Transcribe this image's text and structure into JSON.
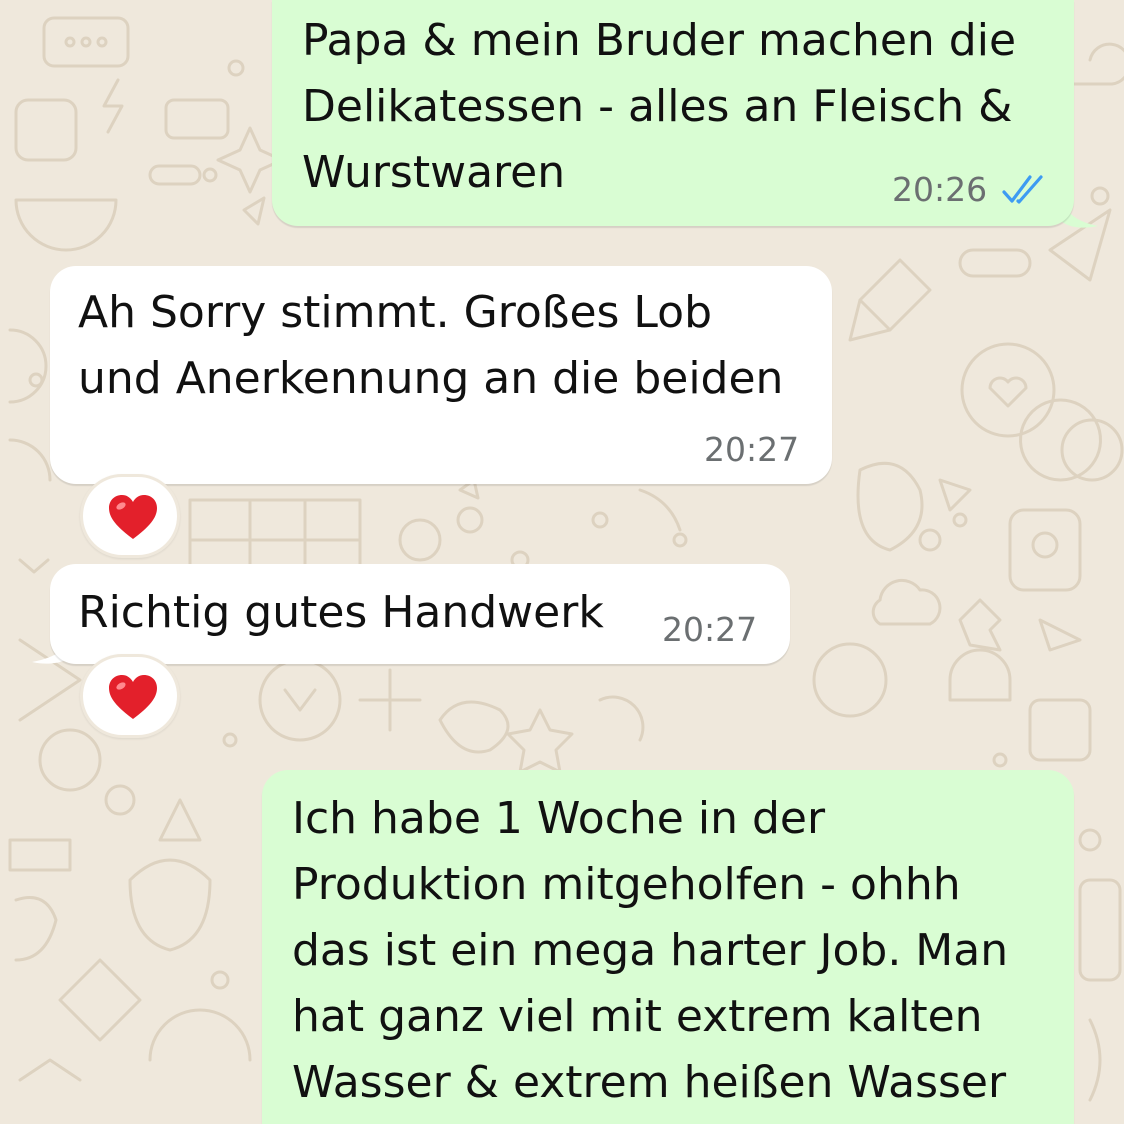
{
  "messages": [
    {
      "direction": "outgoing",
      "text": "Papa & mein Bruder machen die\nDelikatessen - alles an Fleisch &\nWurstwaren",
      "time": "20:26",
      "status": "read-double-check-icon"
    },
    {
      "direction": "incoming",
      "text": "Ah Sorry stimmt. Großes Lob\nund Anerkennung an die beiden",
      "time": "20:27",
      "reaction": "red-heart"
    },
    {
      "direction": "incoming",
      "text": "Richtig gutes Handwerk",
      "time": "20:27",
      "reaction": "red-heart"
    },
    {
      "direction": "outgoing",
      "text": "Ich habe 1 Woche in der\nProduktion mitgeholfen - ohhh\ndas ist ein mega harter Job. Man\nhat ganz viel mit extrem kalten\nWasser & extrem heißen Wasser"
    }
  ],
  "colors": {
    "outgoing_bubble": "#d9fdd3",
    "incoming_bubble": "#ffffff",
    "wallpaper": "#efe8dc",
    "read_check": "#3d9bf2",
    "timestamp": "#6b6f71",
    "heart": "#e3202b"
  }
}
